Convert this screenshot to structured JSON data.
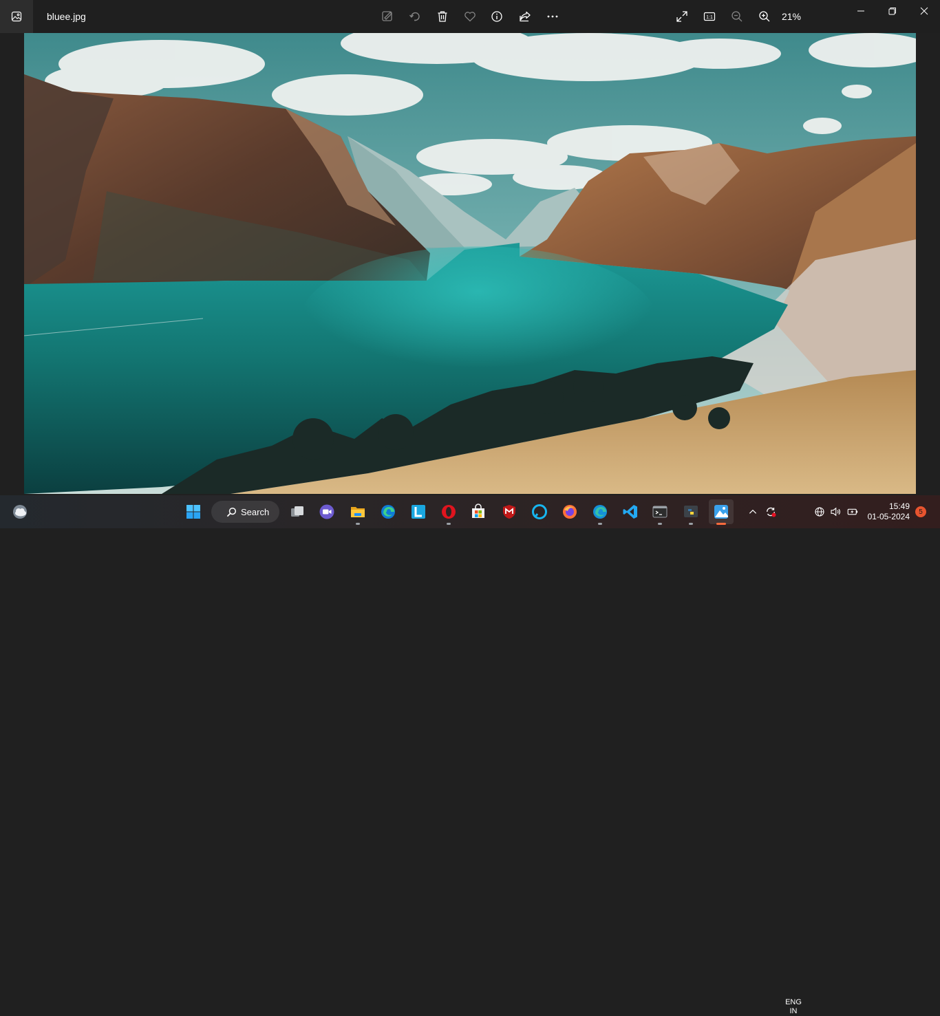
{
  "titlebar": {
    "file_name": "bluee.jpg",
    "zoom_level": "21%",
    "zoom_one_to_one_label": "1:1",
    "toolbar_icons": [
      "edit-image-icon",
      "rotate-icon",
      "delete-icon",
      "favorite-icon",
      "info-icon",
      "share-icon",
      "more-icon"
    ],
    "view_icons": [
      "fullscreen-icon",
      "actual-size-icon",
      "zoom-out-icon",
      "zoom-in-icon"
    ]
  },
  "taskbar": {
    "search_label": "Search",
    "apps": [
      "start",
      "search",
      "task-view",
      "meet",
      "file-explorer",
      "edge",
      "lumion",
      "opera",
      "microsoft-store",
      "mcafee",
      "alexa",
      "firefox",
      "edge-alt",
      "vscode",
      "terminal",
      "python",
      "photos"
    ],
    "tray": {
      "lang_line1": "ENG",
      "lang_line2": "IN",
      "time": "15:49",
      "date": "01-05-2024",
      "notification_count": "5"
    }
  },
  "colors": {
    "titlebar_bg": "#1f1f1f",
    "active_app_indicator": "#ff6b3d",
    "notification_badge": "#e8542f"
  }
}
